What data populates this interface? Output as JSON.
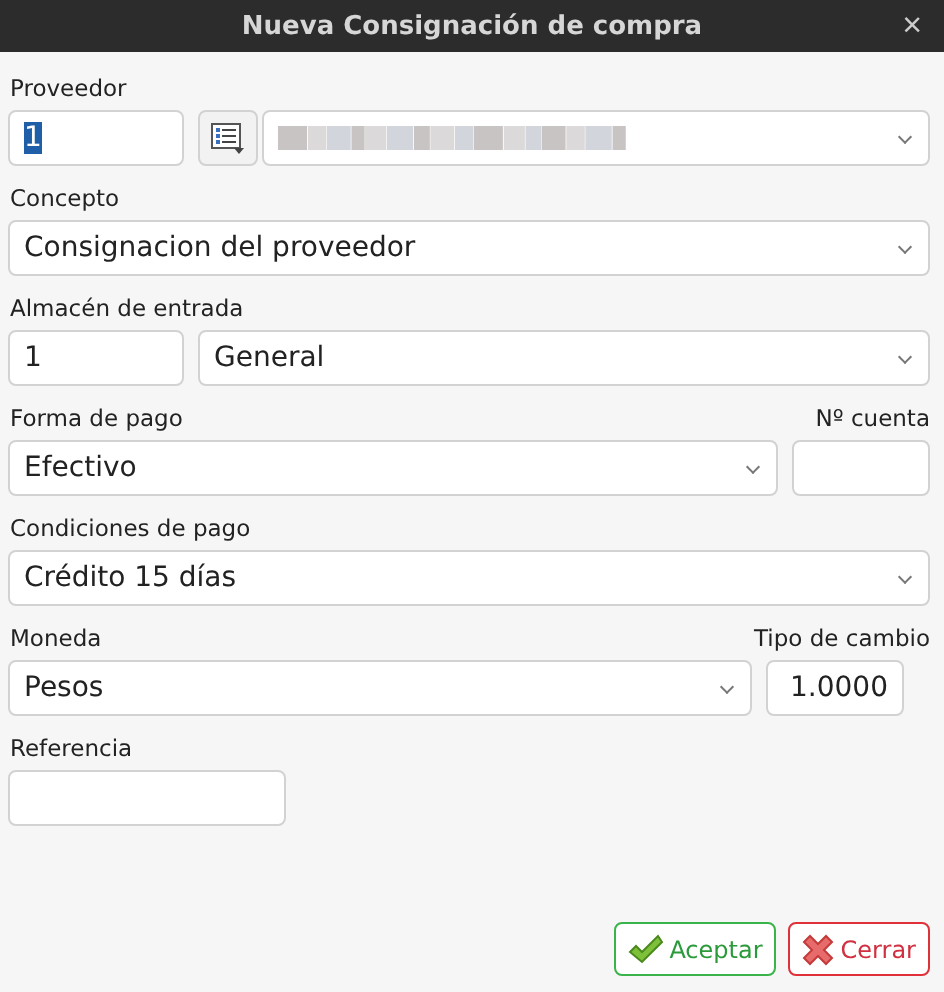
{
  "window": {
    "title": "Nueva Consignación de compra",
    "close": "×"
  },
  "proveedor": {
    "label": "Proveedor",
    "code": "1",
    "code_highlighted": true
  },
  "concepto": {
    "label": "Concepto",
    "value": "Consignacion del proveedor"
  },
  "almacen": {
    "label": "Almacén de entrada",
    "code": "1",
    "value": "General"
  },
  "forma_pago": {
    "label": "Forma de pago",
    "value": "Efectivo",
    "account_label": "Nº cuenta"
  },
  "condiciones": {
    "label": "Condiciones de pago",
    "value": "Crédito 15 días"
  },
  "moneda": {
    "label": "Moneda",
    "value": "Pesos",
    "rate_label": "Tipo de cambio",
    "rate": "1.0000"
  },
  "referencia": {
    "label": "Referencia"
  },
  "buttons": [
    {
      "kind": "accept",
      "label": "Aceptar"
    },
    {
      "kind": "cancel",
      "label": "Cerrar"
    }
  ]
}
